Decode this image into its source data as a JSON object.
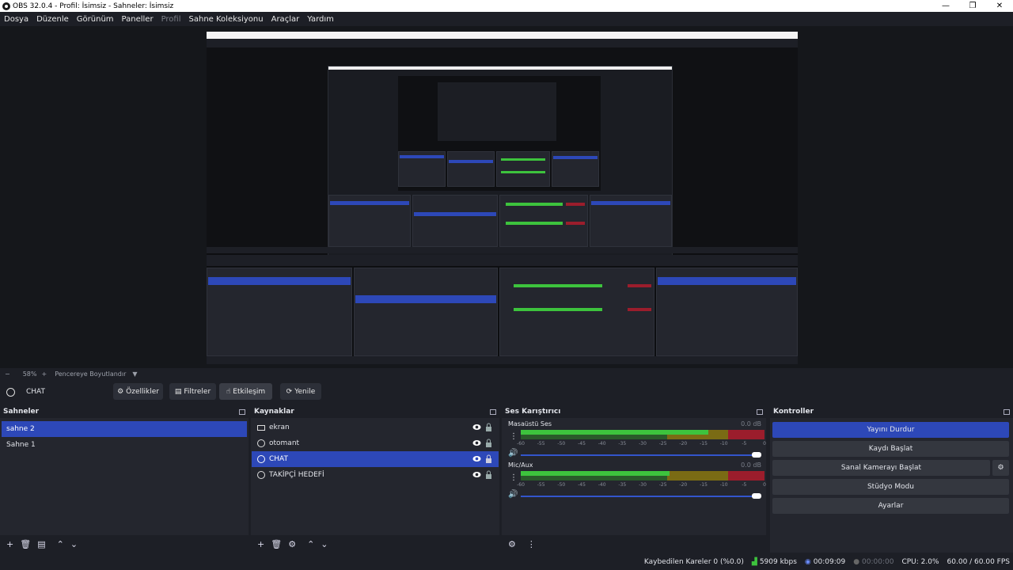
{
  "window": {
    "title": "OBS 32.0.4 - Profil: İsimsiz - Sahneler: İsimsiz",
    "controls": [
      "minimize-icon",
      "restore-icon",
      "close-icon"
    ]
  },
  "menu": [
    "Dosya",
    "Düzenle",
    "Görünüm",
    "Paneller",
    "Profil",
    "Sahne Koleksiyonu",
    "Araçlar",
    "Yardım"
  ],
  "zoom_bar": {
    "minus": "−",
    "zoom": "58%",
    "plus": "+",
    "mode": "Pencereye Boyutlandır"
  },
  "toolbar": {
    "source_name": "CHAT",
    "properties": "Özellikler",
    "filters": "Filtreler",
    "interact": "Etkileşim",
    "refresh": "Yenile"
  },
  "scenes": {
    "title": "Sahneler",
    "items": [
      "sahne 2",
      "Sahne 1"
    ],
    "selected": 0
  },
  "sources": {
    "title": "Kaynaklar",
    "items": [
      {
        "name": "ekran",
        "icon": "monitor-icon"
      },
      {
        "name": "otomant",
        "icon": "globe-icon"
      },
      {
        "name": "CHAT",
        "icon": "globe-icon"
      },
      {
        "name": "TAKİPÇİ HEDEFİ",
        "icon": "globe-icon"
      }
    ],
    "selected": 2
  },
  "mixer": {
    "title": "Ses Karıştırıcı",
    "channels": [
      {
        "name": "Masaüstü Ses",
        "db": "0.0 dB",
        "level": 0.77
      },
      {
        "name": "Mic/Aux",
        "db": "0.0 dB",
        "level": 0.61
      }
    ],
    "scale": [
      "-60",
      "-55",
      "-50",
      "-45",
      "-40",
      "-35",
      "-30",
      "-25",
      "-20",
      "-15",
      "-10",
      "-5",
      "0"
    ]
  },
  "controls": {
    "title": "Kontroller",
    "buttons": [
      "Yayını Durdur",
      "Kaydı Başlat",
      "Sanal Kamerayı Başlat",
      "Stüdyo Modu",
      "Ayarlar"
    ]
  },
  "status": {
    "dropped": "Kaybedilen Kareler 0 (%0.0)",
    "bitrate": "5909 kbps",
    "stream_time": "00:09:09",
    "rec_time": "00:00:00",
    "cpu": "CPU: 2.0%",
    "fps": "60.00 / 60.00 FPS"
  },
  "colors": {
    "accent": "#2d48b8",
    "panel": "#24262e",
    "background": "#1d1f26",
    "meter_green": "#3dc33d",
    "meter_yellow": "#7a6b14",
    "meter_red": "#9b1d2c"
  }
}
